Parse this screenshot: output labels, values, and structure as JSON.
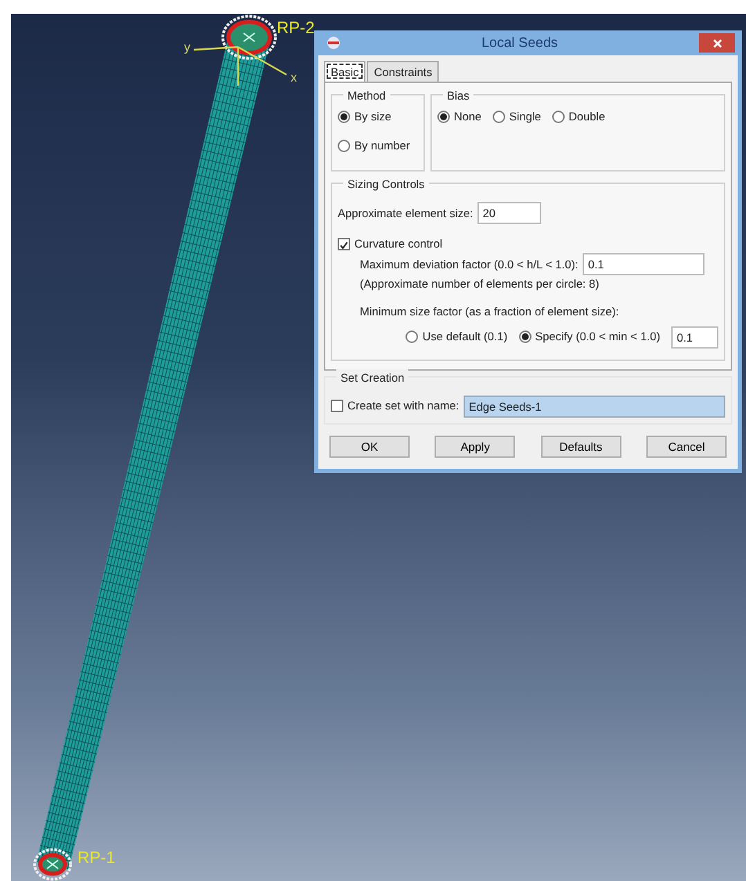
{
  "viewport": {
    "labels": [
      {
        "kind": "rp",
        "text": "RP-2"
      },
      {
        "kind": "rp",
        "text": "RP-1"
      },
      {
        "kind": "axis",
        "text": "y"
      },
      {
        "kind": "axis",
        "text": "x"
      }
    ]
  },
  "dialog": {
    "title": "Local Seeds",
    "tabs": [
      {
        "label": "Basic",
        "selected": true
      },
      {
        "label": "Constraints",
        "selected": false
      }
    ],
    "method": {
      "title": "Method",
      "options": [
        {
          "label": "By size",
          "selected": true
        },
        {
          "label": "By number",
          "selected": false
        }
      ]
    },
    "bias": {
      "title": "Bias",
      "options": [
        {
          "label": "None",
          "selected": true
        },
        {
          "label": "Single",
          "selected": false
        },
        {
          "label": "Double",
          "selected": false
        }
      ]
    },
    "sizing": {
      "title": "Sizing Controls",
      "approx_size": {
        "label": "Approximate element size:",
        "value": "20"
      },
      "curvature": {
        "label": "Curvature control",
        "checked": true
      },
      "max_deviation": {
        "label": "Maximum deviation factor (0.0 < h/L < 1.0):",
        "value": "0.1"
      },
      "note": "(Approximate number of elements per circle: 8)",
      "min_size": {
        "label": "Minimum size factor (as a fraction of element size):",
        "options": [
          {
            "label": "Use default (0.1)",
            "selected": false
          },
          {
            "label": "Specify (0.0 < min < 1.0)",
            "selected": true
          }
        ],
        "value": "0.1"
      }
    },
    "set_creation": {
      "title": "Set Creation",
      "checkbox": {
        "label": "Create set with name:",
        "checked": false
      },
      "value": "Edge Seeds-1"
    },
    "buttons": [
      "OK",
      "Apply",
      "Defaults",
      "Cancel"
    ]
  }
}
